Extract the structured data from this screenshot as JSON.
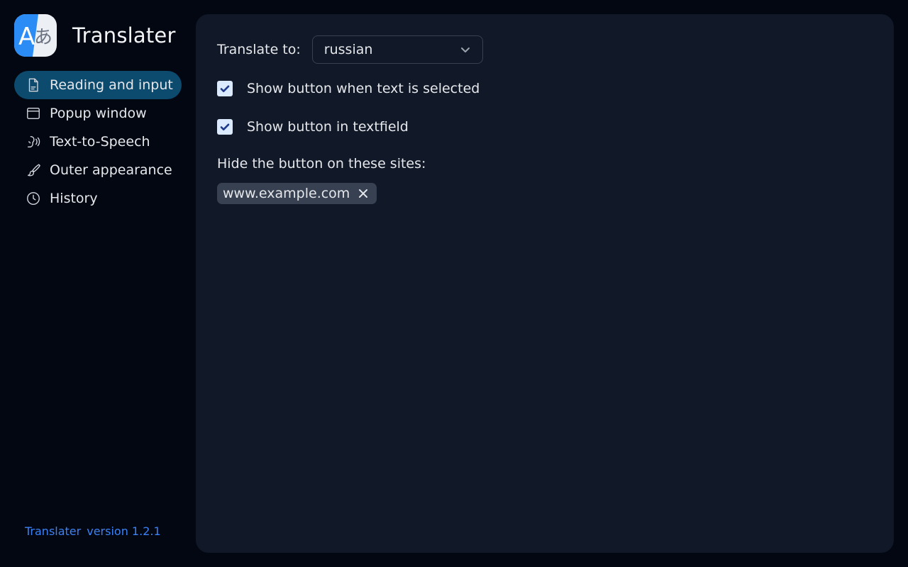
{
  "app": {
    "name": "Translater",
    "logo": {
      "latin": "A",
      "kana": "あ",
      "colors": {
        "left": "#2b8cf5",
        "right": "#eceff4"
      }
    }
  },
  "sidebar": {
    "items": [
      {
        "label": "Reading and input",
        "icon": "document-icon",
        "active": true
      },
      {
        "label": "Popup window",
        "icon": "window-icon",
        "active": false
      },
      {
        "label": "Text-to-Speech",
        "icon": "speech-icon",
        "active": false
      },
      {
        "label": "Outer appearance",
        "icon": "brush-icon",
        "active": false
      },
      {
        "label": "History",
        "icon": "clock-icon",
        "active": false
      }
    ],
    "version": {
      "app": "Translater",
      "label": "version 1.2.1"
    }
  },
  "settings": {
    "translate_to": {
      "label": "Translate to:",
      "value": "russian"
    },
    "show_on_selection": {
      "label": "Show button when text is selected",
      "checked": true
    },
    "show_in_textfield": {
      "label": "Show button in textfield",
      "checked": true
    },
    "hidden_sites": {
      "label": "Hide the button on these sites:",
      "sites": [
        "www.example.com"
      ]
    }
  },
  "colors": {
    "background": "#030712",
    "panel": "#111827",
    "active_nav": "#0c4a6e",
    "accent_link": "#3b82f6",
    "checkbox": "#dbeafe",
    "chip": "#374151"
  }
}
